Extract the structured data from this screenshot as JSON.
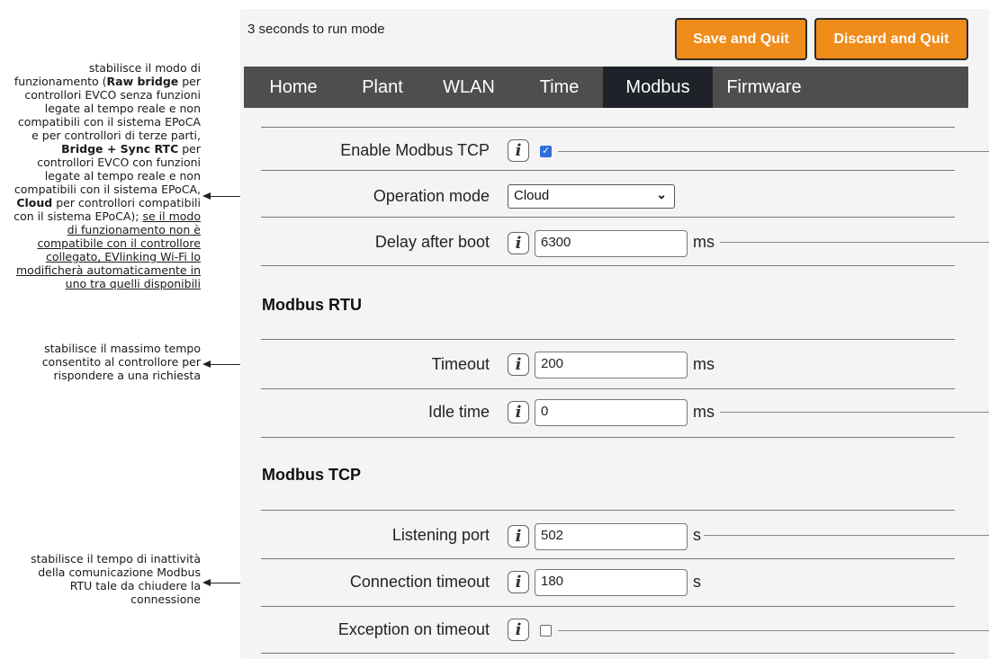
{
  "status_text": "3 seconds to run mode",
  "buttons": {
    "save": "Save and Quit",
    "discard": "Discard and Quit"
  },
  "tabs": [
    "Home",
    "Plant",
    "WLAN",
    "Time",
    "Modbus",
    "Firmware"
  ],
  "active_tab": "Modbus",
  "settings": {
    "enable_modbus_tcp": {
      "label": "Enable Modbus TCP",
      "checked": true
    },
    "operation_mode": {
      "label": "Operation mode",
      "value": "Cloud"
    },
    "delay_after_boot": {
      "label": "Delay after boot",
      "value": "6300",
      "unit": "ms"
    }
  },
  "modbus_rtu": {
    "title": "Modbus RTU",
    "timeout": {
      "label": "Timeout",
      "value": "200",
      "unit": "ms"
    },
    "idle_time": {
      "label": "Idle time",
      "value": "0",
      "unit": "ms"
    }
  },
  "modbus_tcp": {
    "title": "Modbus TCP",
    "listening_port": {
      "label": "Listening port",
      "value": "502",
      "unit": "s"
    },
    "connection_timeout": {
      "label": "Connection timeout",
      "value": "180",
      "unit": "s"
    },
    "exception_on_timeout": {
      "label": "Exception on timeout",
      "checked": false
    }
  },
  "annotations": {
    "operation_mode": {
      "p1": "stabilisce il modo di funzionamento (",
      "b1": "Raw bridge",
      "p2": " per controllori EVCO senza funzioni legate al tempo reale e non compatibili con il sistema EPoCA e per controllori di terze parti, ",
      "b2": "Bridge + Sync RTC",
      "p3": " per controllori EVCO con funzioni legate al tempo reale e non compatibili con il sistema EPoCA, ",
      "b3": "Cloud",
      "p4": " per controllori compatibili con il sistema EPoCA); ",
      "u1": "se il modo di funzionamento non è compatibile con il controllore collegato, EVlinking Wi-Fi lo modificherà automaticamente in uno tra quelli disponibili"
    },
    "timeout": "stabilisce il massimo tempo consentito al controllore per rispondere a una richiesta",
    "connection_timeout": "stabilisce il tempo di inattività della comunicazione Modbus RTU tale da chiudere la connessione"
  },
  "icons": {
    "info": "info-icon",
    "caret": "chevron-down-icon"
  },
  "colors": {
    "accent_button": "#f08c1a",
    "navbar": "#4e4e4e",
    "active_tab": "#1f2329",
    "checkbox": "#2f6fdc"
  }
}
